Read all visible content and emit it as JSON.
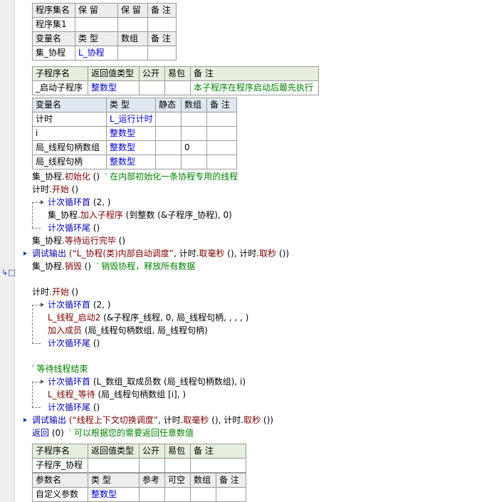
{
  "program_set_table": {
    "headers": [
      "程序集名",
      "保 留",
      "保 留",
      "备 注"
    ],
    "row": [
      "程序集1",
      "",
      "",
      ""
    ],
    "var_headers": [
      "变量名",
      "类 型",
      "数组",
      "备 注"
    ],
    "var_row": {
      "name": "集_协程",
      "type": "L_协程",
      "array": "",
      "note": ""
    }
  },
  "sub_table": {
    "headers": [
      "子程序名",
      "返回值类型",
      "公开",
      "易包",
      "备 注"
    ],
    "row": {
      "name": "_启动子程序",
      "ret": "整数型",
      "pub": "",
      "epkg": "",
      "note": "本子程序在程序启动后最先执行"
    }
  },
  "local_vars": {
    "headers": [
      "变量名",
      "类 型",
      "静态",
      "数组",
      "备 注"
    ],
    "rows": [
      {
        "name": "计时",
        "type": "L_运行计时",
        "static": "",
        "array": "",
        "note": ""
      },
      {
        "name": "i",
        "type": "整数型",
        "static": "",
        "array": "",
        "note": ""
      },
      {
        "name": "局_线程句柄数组",
        "type": "整数型",
        "static": "",
        "array": "0",
        "note": ""
      },
      {
        "name": "局_线程句柄",
        "type": "整数型",
        "static": "",
        "array": "",
        "note": ""
      }
    ]
  },
  "code": {
    "l1_obj": "集_协程",
    "l1_meth": "初始化",
    "l1_args": " ()",
    "l1_comment": "  ′ 在内部初始化一条协程专用的线程",
    "l2_obj": "计时",
    "l2_meth": "开始",
    "l2_args": " ()",
    "l3_kw": "计次循环首",
    "l3_args": " (2, )",
    "l4_obj": "集_协程",
    "l4_meth": "加入子程序",
    "l4_args": " (到整数 (&子程序_协程), 0)",
    "l5_kw": "计次循环尾",
    "l5_args": " ()",
    "l6_obj": "集_协程",
    "l6_meth": "等待运行完毕",
    "l6_args": " ()",
    "l7_kw": "调试输出",
    "l7_str": " (“L_协程(类)内部自动调度”",
    "l7_mid": ", 计时",
    "l7_m1": "取毫秒",
    "l7_mid2": " (), 计时",
    "l7_m2": "取秒",
    "l7_end": " ())",
    "l8_obj": "集_协程",
    "l8_meth": "销毁",
    "l8_args": " ()",
    "l8_comment": "  ′ 销毁协程，释放所有数据",
    "l9_obj": "计时",
    "l9_meth": "开始",
    "l9_args": " ()",
    "l10_kw": "计次循环首",
    "l10_args": " (2, )",
    "l11_kw": "L_线程_启动2",
    "l11_args": " (&子程序_线程, 0, 局_线程句柄, , , , )",
    "l12_kw": "加入成员",
    "l12_args": " (局_线程句柄数组, 局_线程句柄)",
    "l13_kw": "计次循环尾",
    "l13_args": " ()",
    "l14_comment": "′ 等待线程结束",
    "l15_kw": "计次循环首",
    "l15_args": " (L_数组_取成员数 (局_线程句柄数组), i)",
    "l16_kw": "L_线程_等待",
    "l16_args": " (局_线程句柄数组 [i], )",
    "l17_kw": "计次循环尾",
    "l17_args": " ()",
    "l18_kw": "调试输出",
    "l18_str": " (“线程上下文切换调度”",
    "l18_mid": ", 计时",
    "l18_m1": "取毫秒",
    "l18_mid2": " (), 计时",
    "l18_m2": "取秒",
    "l18_end": " ())",
    "l19_kw": "返回",
    "l19_args": " (0)",
    "l19_comment": "  ′ 可以根据您的需要返回任意数值"
  },
  "sub_table2": {
    "headers": [
      "子程序名",
      "返回值类型",
      "公开",
      "易包",
      "备 注"
    ],
    "row": {
      "name": "子程序_协程",
      "ret": "",
      "pub": "",
      "epkg": "",
      "note": ""
    },
    "param_headers": [
      "参数名",
      "类 型",
      "参考",
      "可空",
      "数组",
      "备 注"
    ],
    "param_row": {
      "name": "自定义参数",
      "type": "整数型"
    }
  },
  "colors": {
    "type_blue": "#0000cc",
    "comment_green": "#008000",
    "method_red": "#7a0000"
  }
}
